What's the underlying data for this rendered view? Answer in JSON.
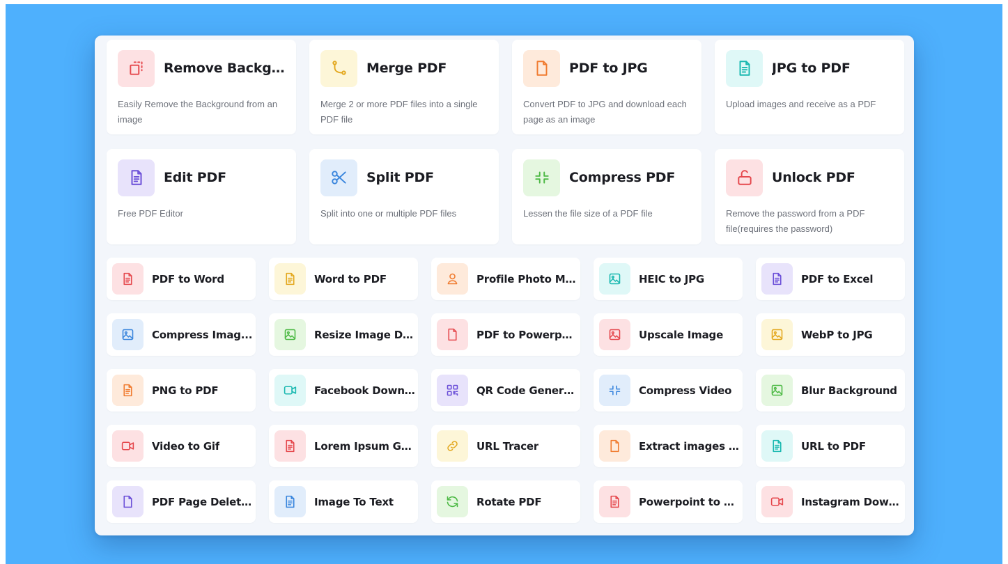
{
  "featured": [
    {
      "title": "Remove Backgr...",
      "desc": "Easily Remove the Background from an image",
      "icon": "remove-background-icon",
      "bg": "#fde1e3",
      "fg": "#e5484d"
    },
    {
      "title": "Merge PDF",
      "desc": "Merge 2 or more PDF files into a single PDF file",
      "icon": "merge-icon",
      "bg": "#fdf6d8",
      "fg": "#e3a81f"
    },
    {
      "title": "PDF to JPG",
      "desc": "Convert PDF to JPG and download each page as an image",
      "icon": "file-icon",
      "bg": "#feeadb",
      "fg": "#f07b2f"
    },
    {
      "title": "JPG to PDF",
      "desc": "Upload images and receive as a PDF",
      "icon": "document-icon",
      "bg": "#dff8f7",
      "fg": "#19b8b0"
    },
    {
      "title": "Edit PDF",
      "desc": "Free PDF Editor",
      "icon": "document-icon",
      "bg": "#e8e3fb",
      "fg": "#6b4fd8"
    },
    {
      "title": "Split PDF",
      "desc": "Split into one or multiple PDF files",
      "icon": "scissors-icon",
      "bg": "#e1edfb",
      "fg": "#3a86dd"
    },
    {
      "title": "Compress PDF",
      "desc": "Lessen the file size of a PDF file",
      "icon": "compress-icon",
      "bg": "#e5f7e0",
      "fg": "#4cb944"
    },
    {
      "title": "Unlock PDF",
      "desc": "Remove the password from a PDF file(requires the password)",
      "icon": "unlock-icon",
      "bg": "#fde1e3",
      "fg": "#e5484d"
    }
  ],
  "tools": [
    {
      "label": "PDF to Word",
      "icon": "document-icon",
      "bg": "#fde1e3",
      "fg": "#e5484d"
    },
    {
      "label": "Word to PDF",
      "icon": "document-icon",
      "bg": "#fdf6d8",
      "fg": "#e3a81f"
    },
    {
      "label": "Profile Photo Ma...",
      "icon": "user-icon",
      "bg": "#feeadb",
      "fg": "#f07b2f"
    },
    {
      "label": "HEIC to JPG",
      "icon": "image-icon",
      "bg": "#dff8f7",
      "fg": "#19b8b0"
    },
    {
      "label": "PDF to Excel",
      "icon": "document-icon",
      "bg": "#e8e3fb",
      "fg": "#6b4fd8"
    },
    {
      "label": "Compress Imag...",
      "icon": "image-icon",
      "bg": "#e1edfb",
      "fg": "#3a86dd"
    },
    {
      "label": "Resize Image Di...",
      "icon": "image-icon",
      "bg": "#e5f7e0",
      "fg": "#4cb944"
    },
    {
      "label": "PDF to Powerpoint",
      "icon": "file-icon",
      "bg": "#fde1e3",
      "fg": "#e5484d"
    },
    {
      "label": "Upscale Image",
      "icon": "image-icon",
      "bg": "#fde1e3",
      "fg": "#e5484d"
    },
    {
      "label": "WebP to JPG",
      "icon": "image-icon",
      "bg": "#fdf6d8",
      "fg": "#e3a81f"
    },
    {
      "label": "PNG to PDF",
      "icon": "document-icon",
      "bg": "#feeadb",
      "fg": "#f07b2f"
    },
    {
      "label": "Facebook Downl...",
      "icon": "video-icon",
      "bg": "#dff8f7",
      "fg": "#19b8b0"
    },
    {
      "label": "QR Code Genera...",
      "icon": "qr-code-icon",
      "bg": "#e8e3fb",
      "fg": "#6b4fd8"
    },
    {
      "label": "Compress Video",
      "icon": "compress-icon",
      "bg": "#e1edfb",
      "fg": "#3a86dd"
    },
    {
      "label": "Blur Background",
      "icon": "image-icon",
      "bg": "#e5f7e0",
      "fg": "#4cb944"
    },
    {
      "label": "Video to Gif",
      "icon": "video-icon",
      "bg": "#fde1e3",
      "fg": "#e5484d"
    },
    {
      "label": "Lorem Ipsum Ge...",
      "icon": "document-icon",
      "bg": "#fde1e3",
      "fg": "#e5484d"
    },
    {
      "label": "URL Tracer",
      "icon": "link-icon",
      "bg": "#fdf6d8",
      "fg": "#e3a81f"
    },
    {
      "label": "Extract images P...",
      "icon": "file-icon",
      "bg": "#feeadb",
      "fg": "#f07b2f"
    },
    {
      "label": "URL to PDF",
      "icon": "document-icon",
      "bg": "#dff8f7",
      "fg": "#19b8b0"
    },
    {
      "label": "PDF Page Deleter",
      "icon": "file-icon",
      "bg": "#e8e3fb",
      "fg": "#6b4fd8"
    },
    {
      "label": "Image To Text",
      "icon": "document-icon",
      "bg": "#e1edfb",
      "fg": "#3a86dd"
    },
    {
      "label": "Rotate PDF",
      "icon": "rotate-icon",
      "bg": "#e5f7e0",
      "fg": "#4cb944"
    },
    {
      "label": "Powerpoint to PDF",
      "icon": "document-icon",
      "bg": "#fde1e3",
      "fg": "#e5484d"
    },
    {
      "label": "Instagram Down...",
      "icon": "video-icon",
      "bg": "#fde1e3",
      "fg": "#e5484d"
    }
  ]
}
